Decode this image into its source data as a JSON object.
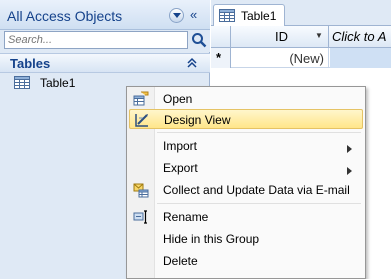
{
  "nav": {
    "title": "All Access Objects",
    "search_placeholder": "Search...",
    "group_title": "Tables",
    "items": [
      {
        "label": "Table1",
        "icon": "table-icon"
      }
    ]
  },
  "doc": {
    "tab_label": "Table1",
    "columns": {
      "id": "ID",
      "add": "Click to A"
    },
    "new_row_marker": "*",
    "new_row_value": "(New)"
  },
  "context_menu": {
    "items": [
      {
        "label": "Open",
        "icon": "open-icon"
      },
      {
        "label": "Design View",
        "icon": "design-view-icon",
        "highlighted": true
      },
      {
        "label": "Import",
        "submenu": true
      },
      {
        "label": "Export",
        "submenu": true
      },
      {
        "label": "Collect and Update Data via E-mail",
        "icon": "collect-data-icon"
      },
      {
        "label": "Rename",
        "icon": "rename-icon"
      },
      {
        "label": "Hide in this Group"
      },
      {
        "label": "Delete"
      }
    ]
  },
  "colors": {
    "nav_background": "#dfe9f5",
    "header_text": "#15428b",
    "highlight": "#ffe68a",
    "add_column_cell": "#cfe0f4"
  }
}
